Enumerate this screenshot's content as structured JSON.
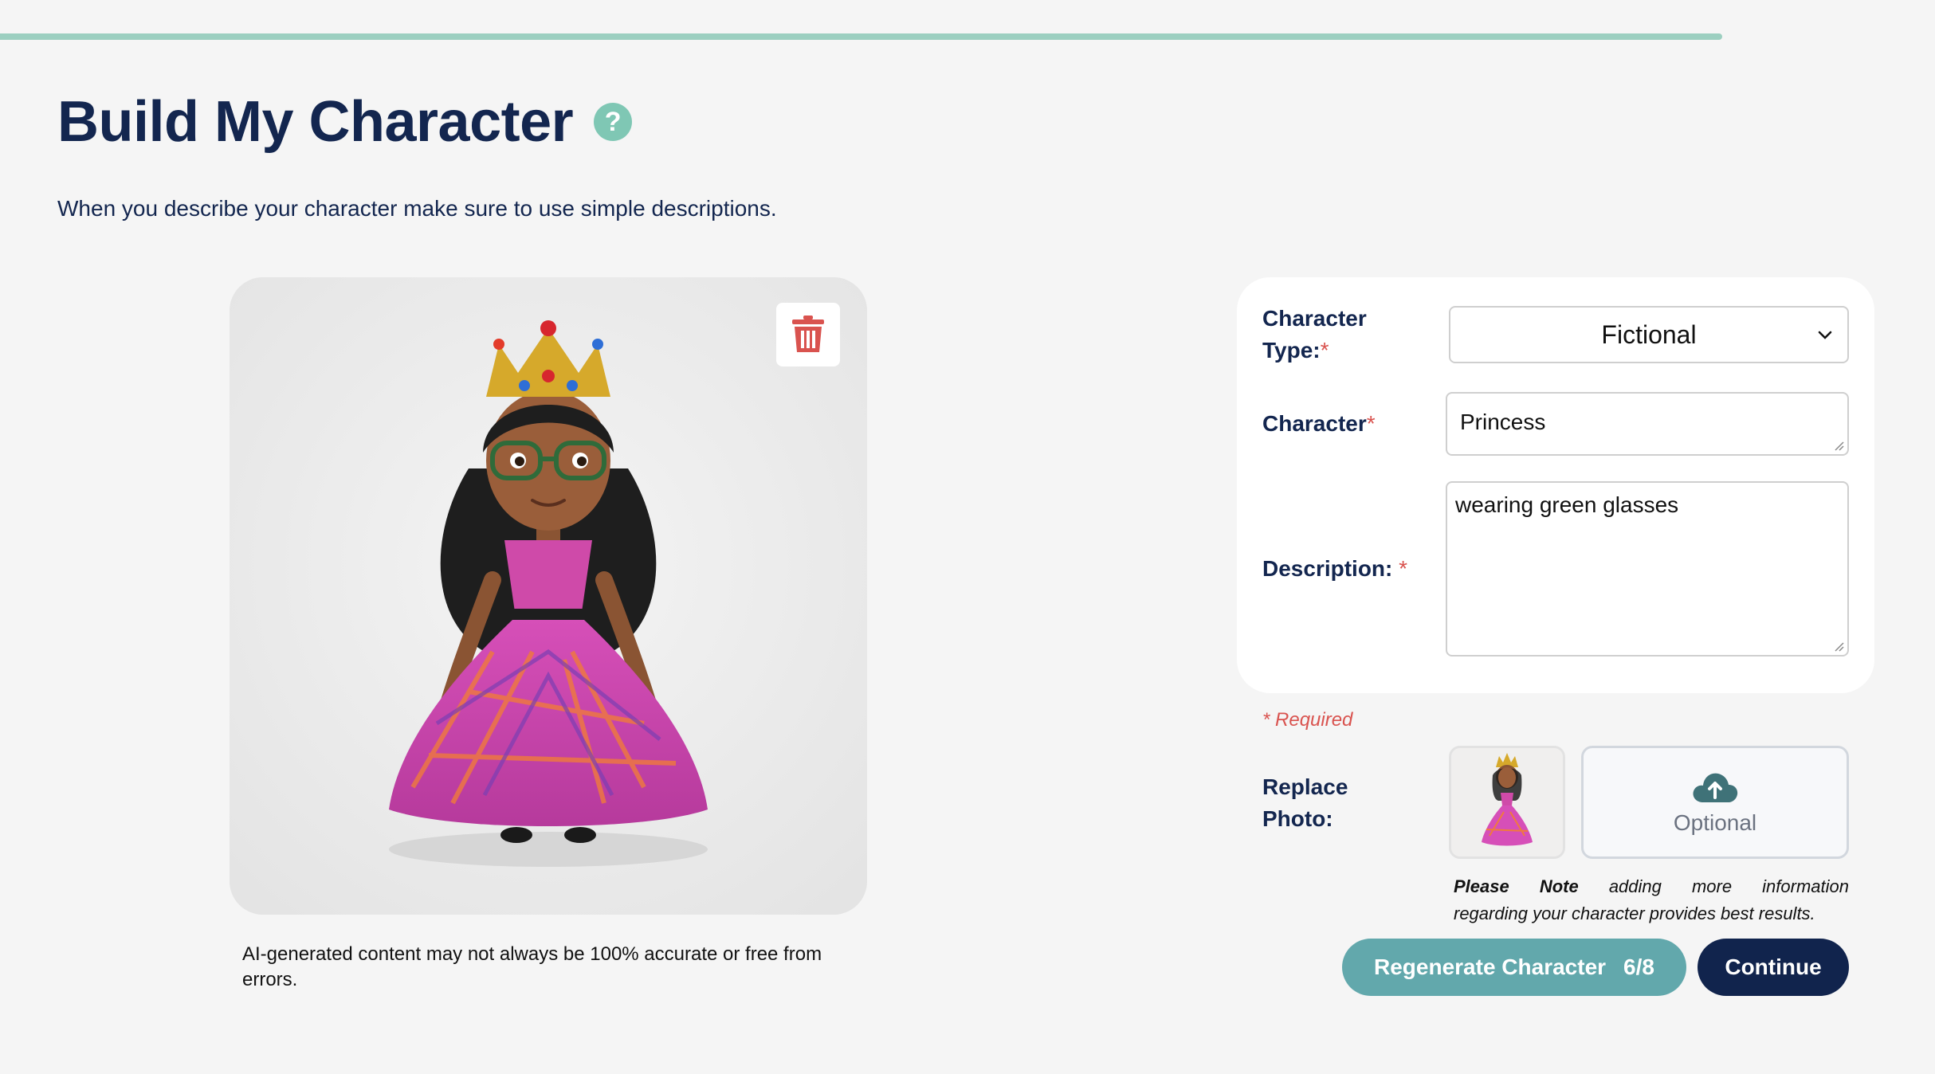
{
  "header": {
    "title": "Build My Character",
    "help_icon": "?",
    "subtitle": "When you describe your character make sure to use simple descriptions."
  },
  "progress": {
    "value": 0.89,
    "color": "#9ccfc0"
  },
  "preview": {
    "delete_icon": "trash-icon",
    "disclaimer": "AI-generated content may not always be 100% accurate or free from errors."
  },
  "form": {
    "character_type": {
      "label_line1": "Character",
      "label_line2": "Type:",
      "required_mark": "*",
      "value": "Fictional"
    },
    "character": {
      "label": "Character",
      "required_mark": "*",
      "value": "Princess"
    },
    "description": {
      "label": "Description:",
      "required_mark": "*",
      "value": "wearing green glasses"
    },
    "required_note": "* Required"
  },
  "replace_photo": {
    "label_line1": "Replace",
    "label_line2": "Photo:",
    "upload_icon": "cloud-upload-icon",
    "upload_label": "Optional"
  },
  "note": {
    "bold1": "Please",
    "bold2": "Note",
    "text_line1": "adding more information",
    "text_line2": "regarding your character provides best results."
  },
  "actions": {
    "regenerate_label": "Regenerate Character",
    "regenerate_count": "6/8",
    "continue_label": "Continue"
  },
  "colors": {
    "navy": "#13264f",
    "teal": "#62a8ac",
    "mint": "#7fc7b4",
    "danger": "#d9534f"
  }
}
